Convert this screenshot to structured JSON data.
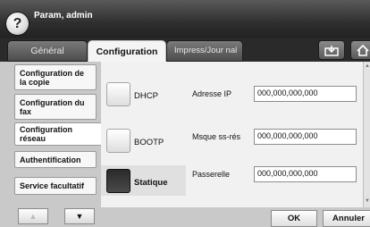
{
  "header": {
    "help_glyph": "?",
    "title": "Param, admin"
  },
  "tabs": [
    {
      "label": "Général",
      "active": false
    },
    {
      "label": "Configuration",
      "active": true
    },
    {
      "label": "Impress/Jour nal",
      "active": false
    }
  ],
  "toolbar": {
    "save_icon": "save-to-tray-icon",
    "home_icon": "home-icon"
  },
  "sidebar": {
    "items": [
      {
        "label": "Configuration de la copie"
      },
      {
        "label": "Configuration du fax"
      },
      {
        "label": "Configuration réseau",
        "selected": true
      },
      {
        "label": "Authentification"
      },
      {
        "label": "Service facultatif"
      }
    ],
    "up_glyph": "▲",
    "down_glyph": "▼"
  },
  "ip_mode": {
    "options": [
      {
        "label": "DHCP",
        "selected": false
      },
      {
        "label": "BOOTP",
        "selected": false
      },
      {
        "label": "Statique",
        "selected": true
      }
    ]
  },
  "fields": [
    {
      "label": "Adresse IP",
      "value": "000,000,000,000"
    },
    {
      "label": "Msque ss-rés",
      "value": "000,000,000,000"
    },
    {
      "label": "Passerelle",
      "value": "000,000,000,000"
    }
  ],
  "footer": {
    "ok_label": "OK",
    "cancel_label": "Annuler"
  },
  "colors": {
    "header_bg": "#2a2a2a",
    "selected_radio": "#2a2a2a",
    "panel_bg": "#c9c9c9"
  }
}
